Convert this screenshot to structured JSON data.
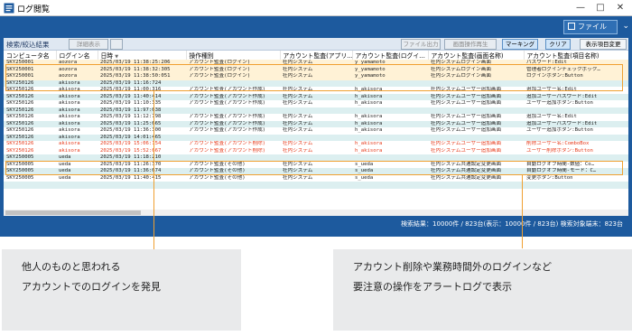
{
  "window": {
    "title": "ログ閲覧"
  },
  "toolbar": {
    "file_label": "ファイル"
  },
  "filter": {
    "label": "検索/絞込結果",
    "buttons": [
      "詳細表示",
      "",
      "ファイル出力",
      "画面操作再生",
      "マーキング",
      "クリア",
      "表示項目変更"
    ]
  },
  "columns": [
    "コンピュータ名",
    "ログイン名",
    "日時",
    "操作種別",
    "アカウント監査(アプリ…",
    "アカウント監査(ログイ…",
    "アカウント監査(画面名称)",
    "アカウント監査(項目名称)"
  ],
  "rows": [
    {
      "cells": [
        "SKY250001",
        "aozora",
        "2025/03/19 11:38:25:206",
        "アカウント監査(ログイン)",
        "社内システム",
        "y_yamamoto",
        "社内システムログイン画面",
        "パスワード:Edit"
      ],
      "style": "sel"
    },
    {
      "cells": [
        "SKY250001",
        "aozora",
        "2025/03/19 11:38:32:305",
        "アカウント監査(ログイン)",
        "社内システム",
        "y_yamamoto",
        "社内システムログイン画面",
        "管理者ログインチェックボック…"
      ],
      "style": "sel"
    },
    {
      "cells": [
        "SKY250001",
        "aozora",
        "2025/03/19 11:38:50:051",
        "アカウント監査(ログイン)",
        "社内システム",
        "y_yamamoto",
        "社内システムログイン画面",
        "ログインボタン:Button"
      ],
      "style": "sel"
    },
    {
      "cells": [
        "SKY250126",
        "akisora",
        "2025/03/19 11:16:724",
        "",
        "",
        "",
        "",
        ""
      ],
      "style": "alt"
    },
    {
      "cells": [
        "SKY250126",
        "akisora",
        "2025/03/19 11:00:316",
        "アカウント監査(アカウント作成)",
        "社内システム",
        "h_akisora",
        "社内システムユーザー追加画面",
        "追加ユーザー名:Edit"
      ],
      "style": ""
    },
    {
      "cells": [
        "SKY250126",
        "akisora",
        "2025/03/19 11:40:414",
        "アカウント監査(アカウント作成)",
        "社内システム",
        "h_akisora",
        "社内システムユーザー追加画面",
        "追加ユーザーパスワード:Edit"
      ],
      "style": "alt"
    },
    {
      "cells": [
        "SKY250126",
        "akisora",
        "2025/03/19 11:10:335",
        "アカウント監査(アカウント作成)",
        "社内システム",
        "h_akisora",
        "社内システムユーザー追加画面",
        "ユーザー追加ボタン:Button"
      ],
      "style": ""
    },
    {
      "cells": [
        "SKY250126",
        "akisora",
        "2025/03/19 11:97:638",
        "",
        "",
        "",
        "",
        ""
      ],
      "style": "alt"
    },
    {
      "cells": [
        "SKY250126",
        "akisora",
        "2025/03/19 11:12:798",
        "アカウント監査(アカウント作成)",
        "社内システム",
        "h_akisora",
        "社内システムユーザー追加画面",
        "追加ユーザー名:Edit"
      ],
      "style": ""
    },
    {
      "cells": [
        "SKY250126",
        "akisora",
        "2025/03/19 11:25:665",
        "アカウント監査(アカウント作成)",
        "社内システム",
        "h_akisora",
        "社内システムユーザー追加画面",
        "追加ユーザーパスワード:Edit"
      ],
      "style": "alt"
    },
    {
      "cells": [
        "SKY250126",
        "akisora",
        "2025/03/19 11:36:300",
        "アカウント監査(アカウント作成)",
        "社内システム",
        "h_akisora",
        "社内システムユーザー追加画面",
        "ユーザー追加ボタン:Button"
      ],
      "style": ""
    },
    {
      "cells": [
        "SKY250126",
        "akisora",
        "2025/03/19 14:01:465",
        "",
        "",
        "",
        "",
        ""
      ],
      "style": "alt"
    },
    {
      "cells": [
        "SKY250126",
        "akisora",
        "2025/03/19 15:06:154",
        "アカウント監査(アカウント削除)",
        "社内システム",
        "h_akisora",
        "社内システムユーザー追加画面",
        "削除ユーザー名:ComboBox"
      ],
      "style": "alert"
    },
    {
      "cells": [
        "SKY250126",
        "akisora",
        "2025/03/19 15:52:667",
        "アカウント監査(アカウント削除)",
        "社内システム",
        "h_akisora",
        "社内システムユーザー追加画面",
        "ユーザー削除ボタン:Button"
      ],
      "style": "alert"
    },
    {
      "cells": [
        "SKY250005",
        "ueda",
        "2025/03/19 11:18:210",
        "",
        "",
        "",
        "",
        ""
      ],
      "style": "alt"
    },
    {
      "cells": [
        "SKY250005",
        "ueda",
        "2025/03/19 11:26:370",
        "アカウント監査(その他)",
        "社内システム",
        "s_ueda",
        "社内システム共通設定変更画面",
        "自動ログオフ時間-数値：Co…"
      ],
      "style": ""
    },
    {
      "cells": [
        "SKY250005",
        "ueda",
        "2025/03/19 11:36:674",
        "アカウント監査(その他)",
        "社内システム",
        "s_ueda",
        "社内システム共通設定変更画面",
        "自動ログオフ時間-モード：C…"
      ],
      "style": "alt"
    },
    {
      "cells": [
        "SKY250005",
        "ueda",
        "2025/03/19 11:40:415",
        "アカウント監査(その他)",
        "社内システム",
        "s_ueda",
        "社内システム共通設定変更画面",
        "変更ボタン:Button"
      ],
      "style": ""
    },
    {
      "cells": [
        "",
        "",
        "",
        "",
        "",
        "",
        "",
        ""
      ],
      "style": "alt"
    }
  ],
  "status": "検索結果：10000件 / 823台(表示：10000件 / 823台)  検索対象端末：823台",
  "callouts": {
    "left": [
      "他人のものと思われる",
      "アカウントでのログインを発見"
    ],
    "right": [
      "アカウント削除や業務時間外のログインなど",
      "要注意の操作をアラートログで表示"
    ]
  },
  "colors": {
    "accent": "#1d5a9e",
    "highlight": "#f0a030",
    "alert_text": "#e63a1a",
    "alt_row": "#dceff0"
  }
}
